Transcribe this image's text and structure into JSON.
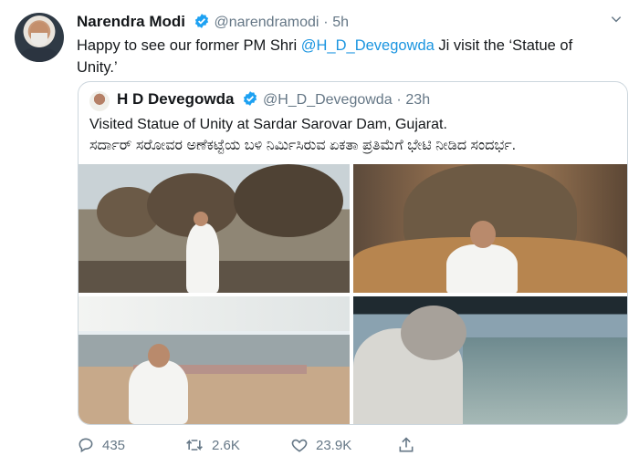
{
  "tweet": {
    "author_name": "Narendra Modi",
    "author_handle": "@narendramodi",
    "separator": "·",
    "time": "5h",
    "text_before": "Happy to see our former PM Shri ",
    "mention": "@H_D_Devegowda",
    "text_after": " Ji visit the ‘Statue of Unity.’",
    "menu_icon": "chevron-down-icon"
  },
  "quoted": {
    "author_name": "H D Devegowda",
    "author_handle": "@H_D_Devegowda",
    "separator": "·",
    "time": "23h",
    "line1": "Visited Statue of Unity at Sardar Sarovar Dam, Gujarat.",
    "line2": "ಸರ್ದಾರ್ ಸರೋವರ ಅಣೆಕಟ್ಟೆಯ ಬಳಿ ನಿರ್ಮಿಸಿರುವ ಏಕತಾ ಪ್ರತಿಮೆಗೆ ಭೇಟಿ ನೀಡಿದ ಸಂದರ್ಭ."
  },
  "actions": {
    "replies": "435",
    "retweets": "2.6K",
    "likes": "23.9K"
  },
  "colors": {
    "verified": "#1da1f2",
    "link": "#1b95e0",
    "muted": "#657786"
  }
}
